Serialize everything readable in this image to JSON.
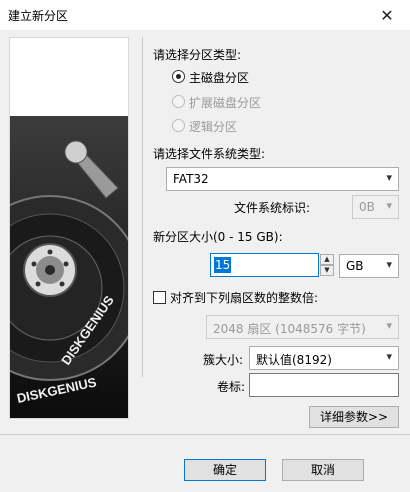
{
  "window": {
    "title": "建立新分区",
    "close_glyph": "✕"
  },
  "side_image": {
    "icon": "hard-disk-illustration"
  },
  "partition_type": {
    "heading": "请选择分区类型:",
    "options": [
      {
        "label": "主磁盘分区",
        "selected": true,
        "enabled": true
      },
      {
        "label": "扩展磁盘分区",
        "selected": false,
        "enabled": false
      },
      {
        "label": "逻辑分区",
        "selected": false,
        "enabled": false
      }
    ]
  },
  "file_system": {
    "heading": "请选择文件系统类型:",
    "value": "FAT32",
    "id_label": "文件系统标识:",
    "id_value": "0B"
  },
  "size": {
    "label": "新分区大小(0 - 15 GB):",
    "value": "15",
    "unit": "GB"
  },
  "align": {
    "label": "对齐到下列扇区数的整数倍:",
    "checked": false,
    "value": "2048 扇区 (1048576 字节)"
  },
  "cluster": {
    "label": "簇大小:",
    "value": "默认值(8192)"
  },
  "volume": {
    "label": "卷标:",
    "value": ""
  },
  "buttons": {
    "details": "详细参数>>",
    "ok": "确定",
    "cancel": "取消"
  },
  "colors": {
    "accent": "#0078d7",
    "disabled_text": "#9a9a9a"
  }
}
